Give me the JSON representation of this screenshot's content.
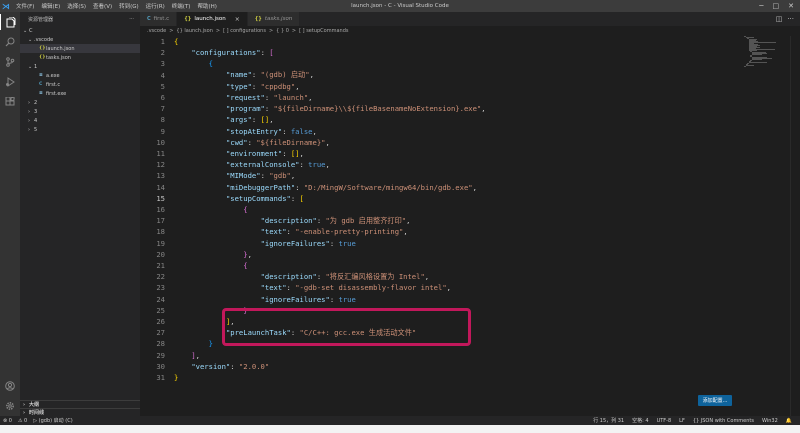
{
  "titlebar": {
    "title": "launch.json - C - Visual Studio Code",
    "menu": [
      "文件(F)",
      "编辑(E)",
      "选择(S)",
      "查看(V)",
      "转到(G)",
      "运行(R)",
      "终端(T)",
      "帮助(H)"
    ],
    "controls": [
      "─",
      "□",
      "✕"
    ]
  },
  "sidebar": {
    "header": "资源管理器",
    "more": "···",
    "tree": [
      {
        "chev": "⌄",
        "icon": "",
        "label": "C",
        "indent": 0
      },
      {
        "chev": "⌄",
        "icon": "",
        "label": ".vscode",
        "indent": 1
      },
      {
        "chev": "",
        "icon": "{}",
        "label": "launch.json",
        "indent": 2,
        "selected": true,
        "type": "json"
      },
      {
        "chev": "",
        "icon": "{}",
        "label": "tasks.json",
        "indent": 2,
        "type": "json"
      },
      {
        "chev": "⌄",
        "icon": "",
        "label": "1",
        "indent": 1
      },
      {
        "chev": "",
        "icon": "≡",
        "label": "a.exe",
        "indent": 2,
        "type": "exe"
      },
      {
        "chev": "",
        "icon": "C",
        "label": "first.c",
        "indent": 2,
        "type": "c"
      },
      {
        "chev": "",
        "icon": "≡",
        "label": "first.exe",
        "indent": 2,
        "type": "exe"
      },
      {
        "chev": "›",
        "icon": "",
        "label": "2",
        "indent": 1
      },
      {
        "chev": "›",
        "icon": "",
        "label": "3",
        "indent": 1
      },
      {
        "chev": "›",
        "icon": "",
        "label": "4",
        "indent": 1
      },
      {
        "chev": "›",
        "icon": "",
        "label": "5",
        "indent": 1
      }
    ],
    "bottom_sections": [
      {
        "chev": "›",
        "label": "大纲"
      },
      {
        "chev": "›",
        "label": "时间线"
      }
    ]
  },
  "tabs": [
    {
      "icon": "C",
      "label": "first.c",
      "active": false,
      "italic": false
    },
    {
      "icon": "{}",
      "label": "launch.json",
      "active": true,
      "italic": false,
      "close": "×"
    },
    {
      "icon": "{}",
      "label": "tasks.json",
      "active": false,
      "italic": true
    }
  ],
  "tab_actions": [
    "◫",
    "···"
  ],
  "breadcrumb": [
    ".vscode",
    ">",
    "{} launch.json",
    ">",
    "[ ] configurations",
    ">",
    "{ } 0",
    ">",
    "[ ] setupCommands"
  ],
  "editor": {
    "current_line": 15,
    "lines": [
      "{",
      "    \"configurations\": [",
      "        {",
      "            \"name\": \"(gdb) 启动\",",
      "            \"type\": \"cppdbg\",",
      "            \"request\": \"launch\",",
      "            \"program\": \"${fileDirname}\\\\${fileBasenameNoExtension}.exe\",",
      "            \"args\": [],",
      "            \"stopAtEntry\": false,",
      "            \"cwd\": \"${fileDirname}\",",
      "            \"environment\": [],",
      "            \"externalConsole\": true,",
      "            \"MIMode\": \"gdb\",",
      "            \"miDebuggerPath\": \"D:/MingW/Software/mingw64/bin/gdb.exe\",",
      "            \"setupCommands\": [",
      "                {",
      "                    \"description\": \"为 gdb 启用整齐打印\",",
      "                    \"text\": \"-enable-pretty-printing\",",
      "                    \"ignoreFailures\": true",
      "                },",
      "                {",
      "                    \"description\": \"将反汇编风格设置为 Intel\",",
      "                    \"text\": \"-gdb-set disassembly-flavor intel\",",
      "                    \"ignoreFailures\": true",
      "                }",
      "            ],",
      "            \"preLaunchTask\": \"C/C++: gcc.exe 生成活动文件\"",
      "        }",
      "    ],",
      "    \"version\": \"2.0.0\"",
      "}"
    ]
  },
  "add_config_button": "添加配置...",
  "statusbar": {
    "left": [
      "⊗ 0",
      "⚠ 0",
      "▷ (gdb) 启动 (C)"
    ],
    "right": [
      "行 15，列 31",
      "空格: 4",
      "UTF-8",
      "LF",
      "{} JSON with Comments",
      "Win32",
      "🔔"
    ]
  },
  "colors": {
    "accent": "#0e639c",
    "highlight_box": "#c2185b",
    "string": "#ce9178",
    "key": "#9cdcfe",
    "keyword": "#569cd6"
  }
}
